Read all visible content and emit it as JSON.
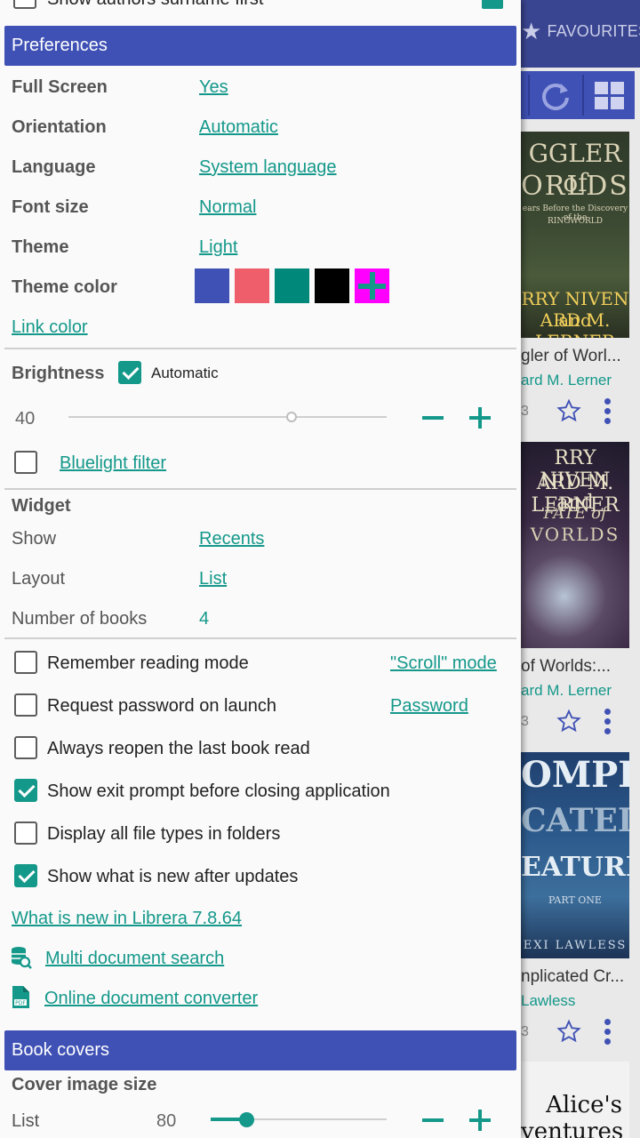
{
  "background": {
    "tab_favourites": "FAVOURITES",
    "books": [
      {
        "cover_line1": "GGLER of",
        "cover_line2": "ORLDS",
        "cover_small1": "ears Before the Discovery of the",
        "cover_small2": "RINGWORLD",
        "cover_line3": "RRY NIVEN and",
        "cover_line4": "ARD M. LERNER",
        "title": "gler of Worl...",
        "author": "ard M. Lerner",
        "num": "3"
      },
      {
        "cover_line1": "RRY NIVEN and",
        "cover_line2": "ARD M. LERNER",
        "cover_small1": "FATE of",
        "cover_small2": "VORLDS",
        "title": " of Worlds:...",
        "author": "ard M. Lerner",
        "num": "3"
      },
      {
        "cover_line1": "OMPL",
        "cover_line2": "CATED",
        "cover_small1": "EATURES",
        "cover_small2": "PART ONE",
        "cover_line3": "EXI LAWLESS",
        "title": "nplicated Cr...",
        "author": "Lawless",
        "num": "3"
      },
      {
        "cover_line1": "Alice's",
        "cover_line2": "ventures in"
      }
    ]
  },
  "top_partial": {
    "label": "Show authors surname first"
  },
  "preferences": {
    "header": "Preferences",
    "rows": [
      {
        "label": "Full Screen",
        "value": "Yes"
      },
      {
        "label": "Orientation",
        "value": "Automatic"
      },
      {
        "label": "Language",
        "value": "System language"
      },
      {
        "label": "Font size",
        "value": "Normal"
      },
      {
        "label": "Theme",
        "value": "Light"
      }
    ],
    "theme_color_label": "Theme color",
    "theme_colors": [
      "#3f51b5",
      "#ef5e6b",
      "#00897b",
      "#000000",
      "#ff00ff"
    ],
    "link_color_label": "Link color",
    "brightness_label": "Brightness",
    "brightness_auto_label": "Automatic",
    "brightness_auto_checked": true,
    "brightness_value": "40",
    "bluelight_label": "Bluelight filter",
    "bluelight_checked": false
  },
  "widget": {
    "header": "Widget",
    "rows": [
      {
        "label": "Show",
        "value": "Recents"
      },
      {
        "label": "Layout",
        "value": "List"
      },
      {
        "label": "Number of books",
        "value": "4"
      }
    ]
  },
  "options": [
    {
      "label": "Remember reading mode",
      "checked": false,
      "link": "\"Scroll\" mode"
    },
    {
      "label": "Request password on launch",
      "checked": false,
      "link": "Password"
    },
    {
      "label": "Always reopen the last book read",
      "checked": false
    },
    {
      "label": "Show exit prompt before closing application",
      "checked": true
    },
    {
      "label": "Display all file types in folders",
      "checked": false
    },
    {
      "label": "Show what is new after updates",
      "checked": true
    }
  ],
  "links": {
    "whats_new": "What is new in Librera 7.8.64",
    "multi_search": "Multi document search",
    "converter": "Online document converter"
  },
  "book_covers": {
    "header": "Book covers",
    "cover_size_label": "Cover image size",
    "list_label": "List",
    "list_value": "80",
    "list_fraction": 0.2
  },
  "colors": {
    "accent": "#14988a",
    "primary": "#3f51b5"
  }
}
